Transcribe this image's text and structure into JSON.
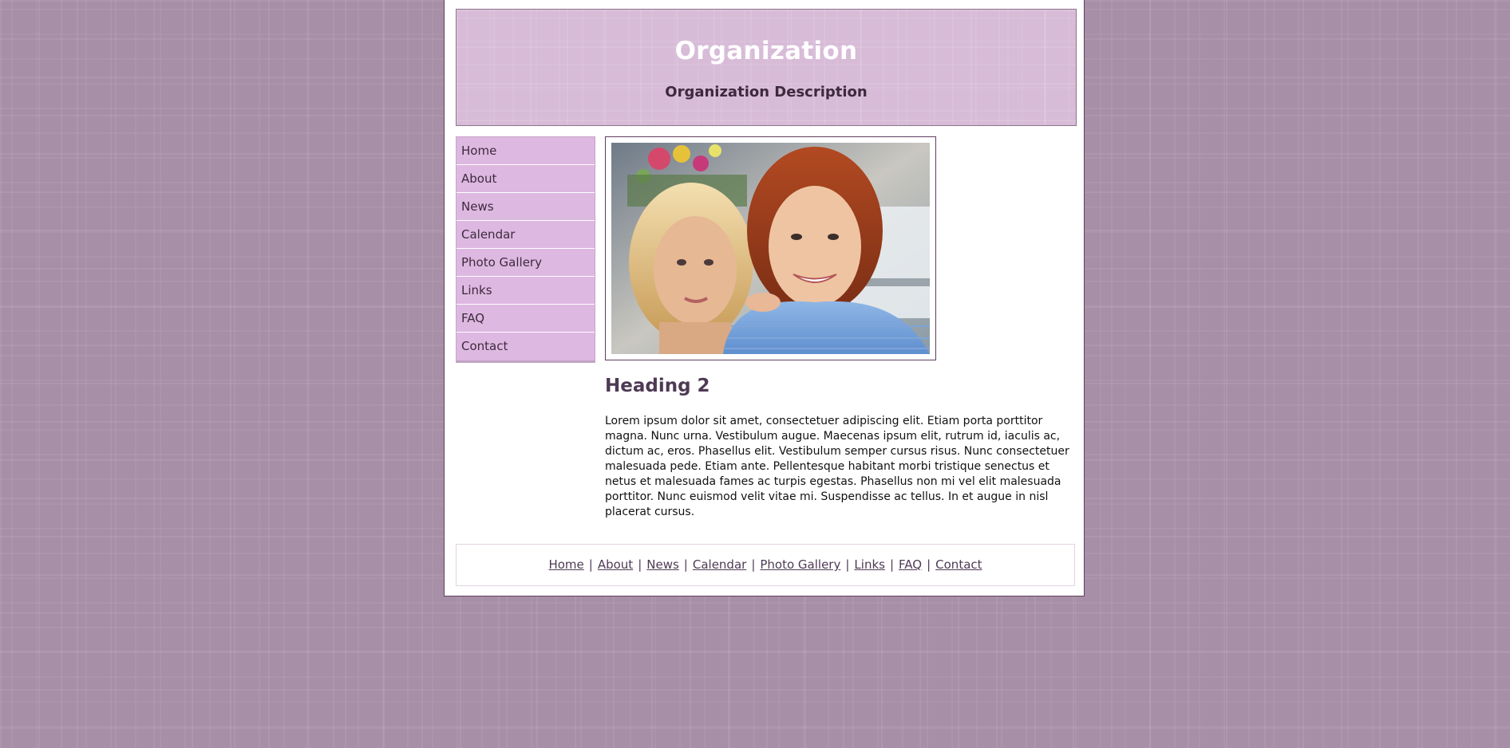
{
  "header": {
    "title": "Organization",
    "description": "Organization Description"
  },
  "nav": {
    "items": [
      {
        "label": "Home"
      },
      {
        "label": "About"
      },
      {
        "label": "News"
      },
      {
        "label": "Calendar"
      },
      {
        "label": "Photo Gallery"
      },
      {
        "label": "Links"
      },
      {
        "label": "FAQ"
      },
      {
        "label": "Contact"
      }
    ]
  },
  "main": {
    "heading": "Heading 2",
    "body": "Lorem ipsum dolor sit amet, consectetuer adipiscing elit. Etiam porta porttitor magna. Nunc urna. Vestibulum augue. Maecenas ipsum elit, rutrum id, iaculis ac, dictum ac, eros. Phasellus elit. Vestibulum semper cursus risus. Nunc consectetuer malesuada pede. Etiam ante. Pellentesque habitant morbi tristique senectus et netus et malesuada fames ac turpis egestas. Phasellus non mi vel elit malesuada porttitor. Nunc euismod velit vitae mi. Suspendisse ac tellus. In et augue in nisl placerat cursus."
  },
  "footer": {
    "links": [
      {
        "label": "Home"
      },
      {
        "label": "About"
      },
      {
        "label": "News"
      },
      {
        "label": "Calendar"
      },
      {
        "label": "Photo Gallery"
      },
      {
        "label": "Links"
      },
      {
        "label": "FAQ"
      },
      {
        "label": "Contact"
      }
    ],
    "separator": "|"
  },
  "colors": {
    "background": "#a78fa7",
    "header_bg": "#d7bbd7",
    "nav_bg": "#ddb8e1",
    "heading_color": "#4e3a54",
    "border": "#5e3e5e"
  }
}
